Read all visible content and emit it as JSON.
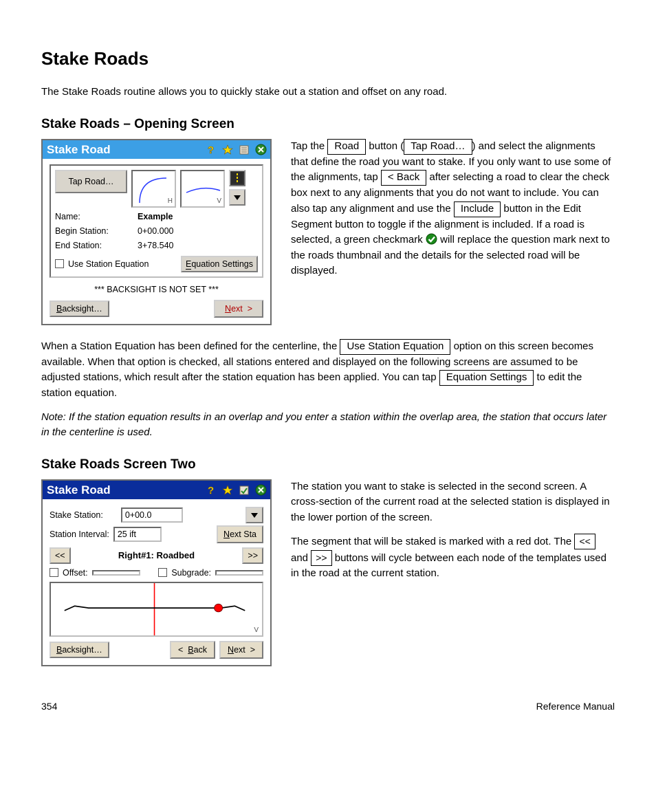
{
  "page_title": "Reference Manual",
  "page_number": "354",
  "text": {
    "h_main": "Stake Roads",
    "p_intro": "The Stake Roads routine allows you to quickly stake out a station and offset on any road.",
    "h_screen1": "Stake Roads – Opening Screen",
    "p_screen1_a1": "Tap the ",
    "p_screen1_a2": " button (",
    "p_screen1_a3": ") and select the alignments that define the road you want to stake. If you only want to use some of the alignments, tap ",
    "p_screen1_a4": " after selecting a road to clear the check box next to any alignments that you do not want to include. You can also tap any alignment and use the ",
    "p_screen1_a5": " button in the ",
    "p_screen1_a6": "Edit Segment",
    "p_screen1_a7": " button to toggle if the alignment is included. If a road is selected, a green checkmark ",
    "p_screen1_a8": " will replace the question mark next to the roads thumbnail and the details for the selected road will be displayed.",
    "p_eqn1": "When a Station Equation has been defined for the centerline, the ",
    "p_eqn2": " option on this screen becomes available. When that option is checked, all stations entered and displayed on the following screens are assumed to be adjusted stations, which result after the station equation has been applied. You can tap ",
    "p_eqn3": " to edit the station equation.",
    "note_eqn": "Note: If the station equation results in an overlap and you enter a station within the overlap area, the station that occurs later in the centerline is used.",
    "h_screen2": "Stake Roads Screen Two",
    "p_screen2_a1": "The station you want to stake is selected in the second screen. A cross-section of the current road at the selected station is displayed in the lower portion of the screen.",
    "p_screen2_a2": "The segment that will be staked is marked with a red dot. The ",
    "p_screen2_a3": " and ",
    "p_screen2_a4": " buttons will cycle between each node of the templates used in the road at the current station."
  },
  "buttons": {
    "road": "Road",
    "tap_road": "Tap Road…",
    "back_alignments": "< Back",
    "include": "Include",
    "use_station_equation": "Use Station Equation",
    "equation_settings": "Equation Settings",
    "lt": "<<",
    "gt": ">>"
  },
  "dialog1": {
    "title": "Stake Road",
    "tap_road": "Tap Road…",
    "name_label": "Name:",
    "name_value": "Example",
    "begin_label": "Begin Station:",
    "begin_value": "0+00.000",
    "end_label": "End Station:",
    "end_value": "3+78.540",
    "use_eqn": "Use Station Equation",
    "eqn_settings": "Equation Settings",
    "warning": "*** BACKSIGHT IS NOT SET ***",
    "backsight": "Backsight…",
    "next": "Next  >",
    "H": "H",
    "V": "V"
  },
  "dialog2": {
    "title": "Stake Road",
    "stake_station": "Stake Station:",
    "stake_station_val": "0+00.0",
    "station_interval": "Station Interval:",
    "station_interval_val": "25 ift",
    "next_sta": "Next Sta",
    "segment_title": "Right#1:  Roadbed",
    "offset": "Offset:",
    "subgrade": "Subgrade:",
    "backsight": "Backsight…",
    "back": "<  Back",
    "next": "Next  >",
    "lt": "<<",
    "gt": ">>",
    "V": "V"
  },
  "footer": {
    "page": "354",
    "label": "Reference Manual"
  }
}
